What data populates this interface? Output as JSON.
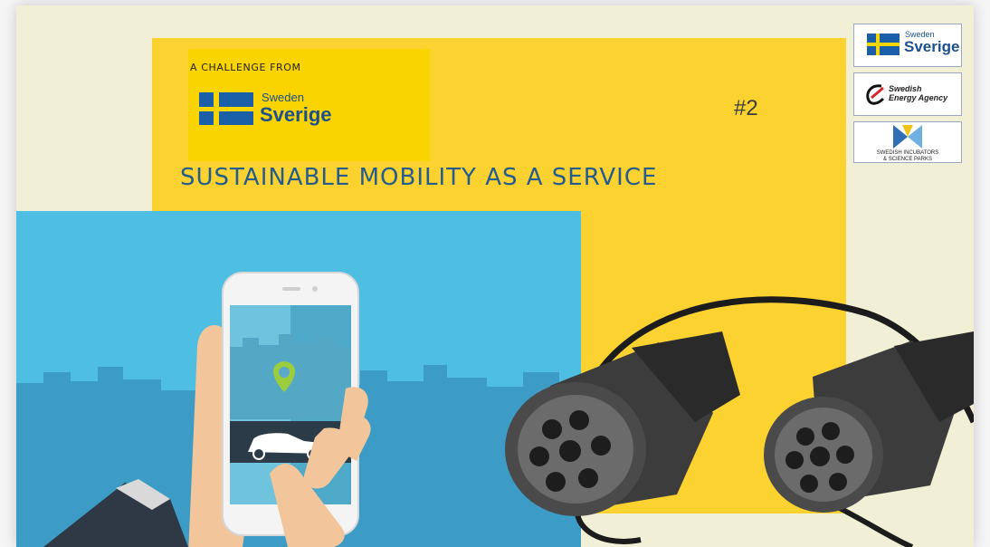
{
  "challenge": {
    "label": "A CHALLENGE FROM",
    "brand_small": "Sweden",
    "brand_big": "Sverige"
  },
  "number": "#2",
  "title": "SUSTAINABLE MOBILITY AS A SERVICE",
  "logos": {
    "sweden_small": "Sweden",
    "sweden_big": "Sverige",
    "energy_line1": "Swedish",
    "energy_line2": "Energy Agency",
    "incubators_line1": "SWEDISH INCUBATORS",
    "incubators_line2": "& SCIENCE PARKS"
  },
  "colors": {
    "background": "#f1f0d6",
    "yellow": "#fbd22f",
    "sky_blue": "#4ebfe3",
    "title_blue": "#245c8e",
    "flag_blue": "#1b5fa8"
  }
}
